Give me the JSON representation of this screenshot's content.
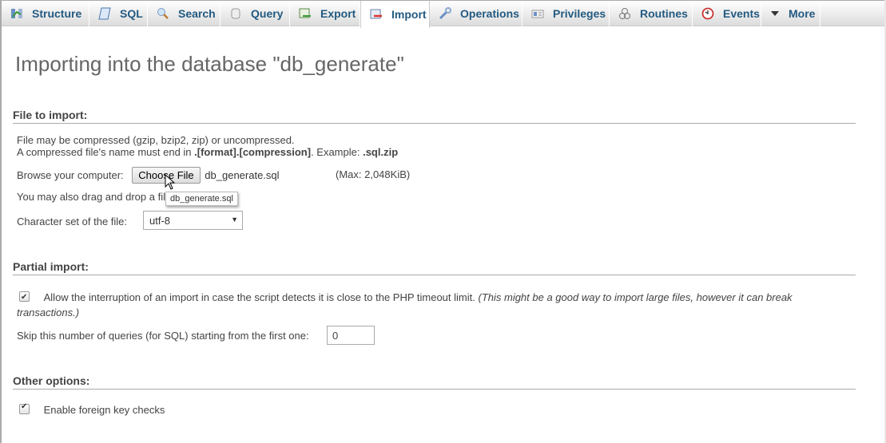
{
  "tabs": [
    {
      "label": "Structure",
      "icon": "structure-icon",
      "active": false
    },
    {
      "label": "SQL",
      "icon": "sql-icon",
      "active": false
    },
    {
      "label": "Search",
      "icon": "search-icon",
      "active": false
    },
    {
      "label": "Query",
      "icon": "query-icon",
      "active": false
    },
    {
      "label": "Export",
      "icon": "export-icon",
      "active": false
    },
    {
      "label": "Import",
      "icon": "import-icon",
      "active": true
    },
    {
      "label": "Operations",
      "icon": "wrench-icon",
      "active": false
    },
    {
      "label": "Privileges",
      "icon": "privileges-icon",
      "active": false
    },
    {
      "label": "Routines",
      "icon": "routines-icon",
      "active": false
    },
    {
      "label": "Events",
      "icon": "clock-icon",
      "active": false
    },
    {
      "label": "More",
      "icon": "triangle-down-icon",
      "active": false
    }
  ],
  "page_title": "Importing into the database \"db_generate\"",
  "file_section": {
    "title": "File to import:",
    "line1": "File may be compressed (gzip, bzip2, zip) or uncompressed.",
    "line2_prefix": "A compressed file's name must end in ",
    "line2_bold": ".[format].[compression]",
    "line2_mid": ". Example: ",
    "line2_example": ".sql.zip",
    "browse_label": "Browse your computer:",
    "choose_button": "Choose File",
    "chosen_file": "db_generate.sql",
    "max_size": "(Max: 2,048KiB)",
    "drag_drop_text": "You may also drag and drop a file on any page.",
    "tooltip": "db_generate.sql",
    "charset_label": "Character set of the file:",
    "charset_value": "utf-8"
  },
  "partial_section": {
    "title": "Partial import:",
    "allow_interrupt_label": "Allow the interruption of an import in case the script detects it is close to the PHP timeout limit.",
    "allow_interrupt_note": "(This might be a good way to import large files, however it can break transactions.)",
    "allow_interrupt_checked": true,
    "skip_label": "Skip this number of queries (for SQL) starting from the first one:",
    "skip_value": "0"
  },
  "other_section": {
    "title": "Other options:",
    "fk_label": "Enable foreign key checks",
    "fk_checked": true
  }
}
